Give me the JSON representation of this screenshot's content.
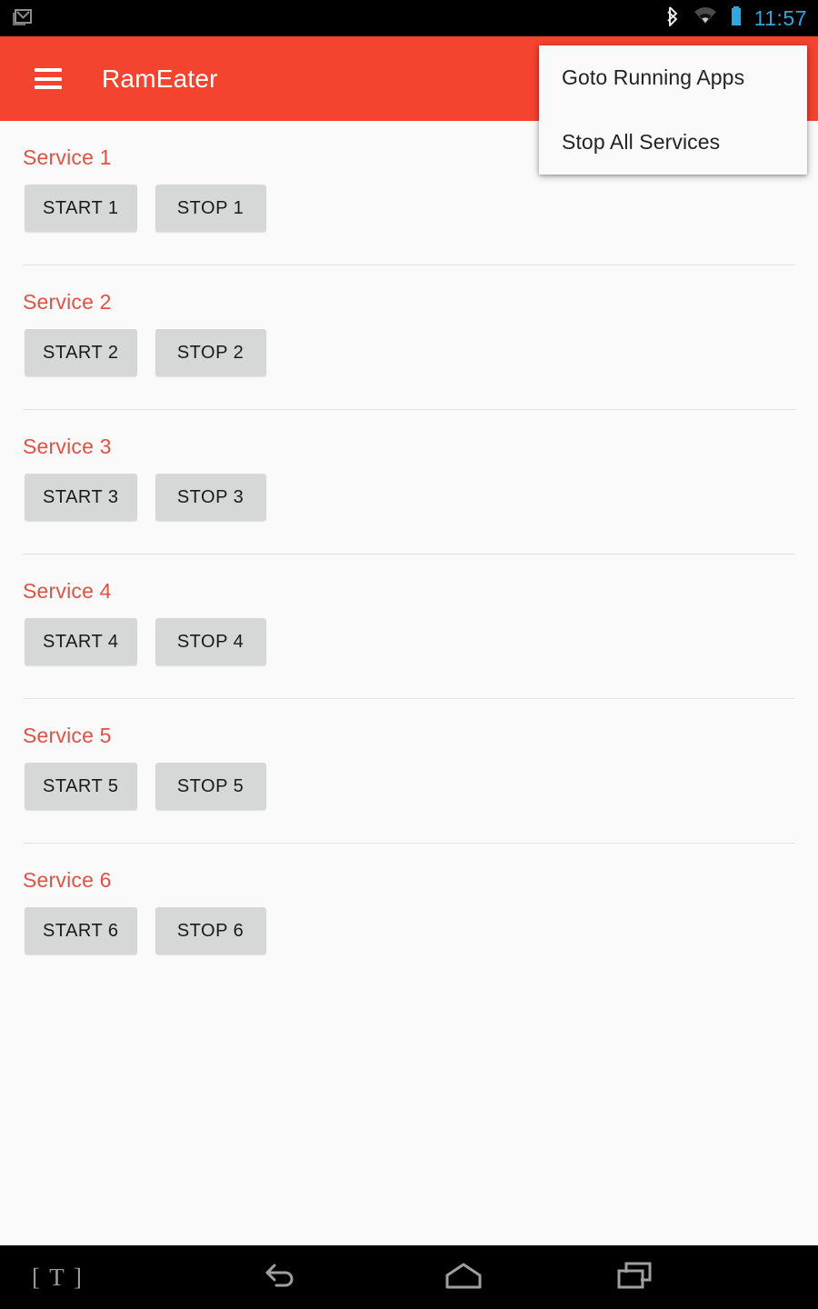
{
  "status_bar": {
    "notification_icon": "gmail-icon",
    "bluetooth_icon": "bluetooth-icon",
    "wifi_icon": "wifi-icon",
    "battery_icon": "battery-icon",
    "clock": "11:57",
    "clock_color": "#30A6DE",
    "background": "#000000"
  },
  "app_bar": {
    "menu_icon": "hamburger-menu-icon",
    "title": "RamEater",
    "background": "#F4432F",
    "text_color": "#FFFFFF"
  },
  "popup_menu": {
    "items": [
      {
        "label": "Goto Running Apps"
      },
      {
        "label": "Stop All Services"
      }
    ],
    "background": "#FAFAFA"
  },
  "content": {
    "label_color": "#E05245",
    "button_color": "#D6D7D7",
    "services": [
      {
        "label": "Service 1",
        "start_label": "START 1",
        "stop_label": "STOP 1",
        "divider": true
      },
      {
        "label": "Service 2",
        "start_label": "START 2",
        "stop_label": "STOP 2",
        "divider": true
      },
      {
        "label": "Service 3",
        "start_label": "START 3",
        "stop_label": "STOP 3",
        "divider": true
      },
      {
        "label": "Service 4",
        "start_label": "START 4",
        "stop_label": "STOP 4",
        "divider": true
      },
      {
        "label": "Service 5",
        "start_label": "START 5",
        "stop_label": "STOP 5",
        "divider": true
      },
      {
        "label": "Service 6",
        "start_label": "START 6",
        "stop_label": "STOP 6",
        "divider": false
      }
    ]
  },
  "nav_bar": {
    "ime_label": "[ T ]",
    "back_icon": "back-arrow-icon",
    "home_icon": "home-icon",
    "recents_icon": "recent-apps-icon",
    "background": "#000000"
  }
}
